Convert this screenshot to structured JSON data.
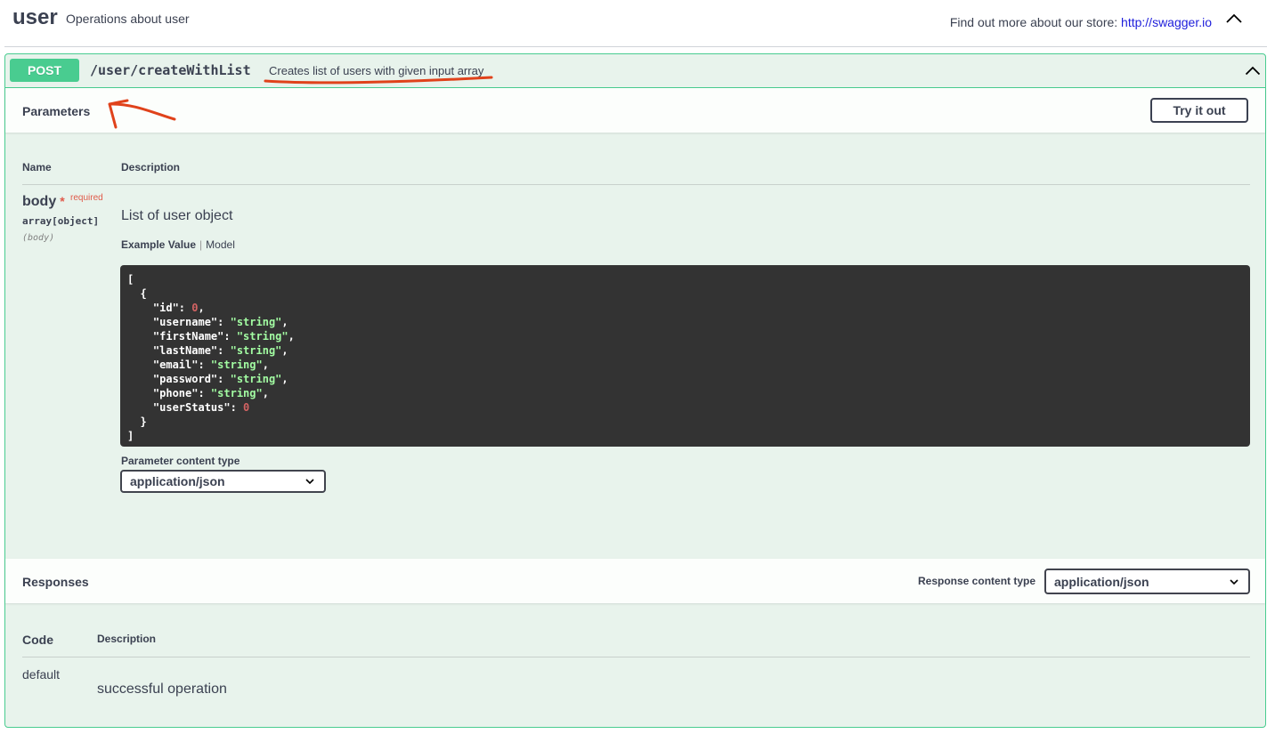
{
  "tag": {
    "name": "user",
    "description": "Operations about user",
    "external_docs_prefix": "Find out more about our store:",
    "external_docs_link": "http://swagger.io"
  },
  "operation": {
    "method": "POST",
    "path": "/user/createWithList",
    "summary": "Creates list of users with given input array",
    "method_color": "#49cc90"
  },
  "parameters": {
    "title": "Parameters",
    "try_it_out_label": "Try it out",
    "columns": [
      "Name",
      "Description"
    ],
    "items": [
      {
        "name": "body",
        "required_star": "*",
        "required_label": "required",
        "type": "array[object]",
        "in": "(body)",
        "description": "List of user object",
        "tabs": [
          "Example Value",
          "Model"
        ],
        "example_lines": [
          "[",
          "  {",
          "    \"id\": 0,",
          "    \"username\": \"string\",",
          "    \"firstName\": \"string\",",
          "    \"lastName\": \"string\",",
          "    \"email\": \"string\",",
          "    \"password\": \"string\",",
          "    \"phone\": \"string\",",
          "    \"userStatus\": 0",
          "  }",
          "]"
        ]
      }
    ],
    "content_type_label": "Parameter content type",
    "content_type_value": "application/json"
  },
  "responses": {
    "title": "Responses",
    "content_type_label": "Response content type",
    "content_type_value": "application/json",
    "columns": [
      "Code",
      "Description"
    ],
    "rows": [
      {
        "code": "default",
        "description": "successful operation"
      }
    ]
  },
  "annotation_color": "#e0421b",
  "icons": [
    "chevron-up-icon",
    "chevron-down-icon"
  ]
}
